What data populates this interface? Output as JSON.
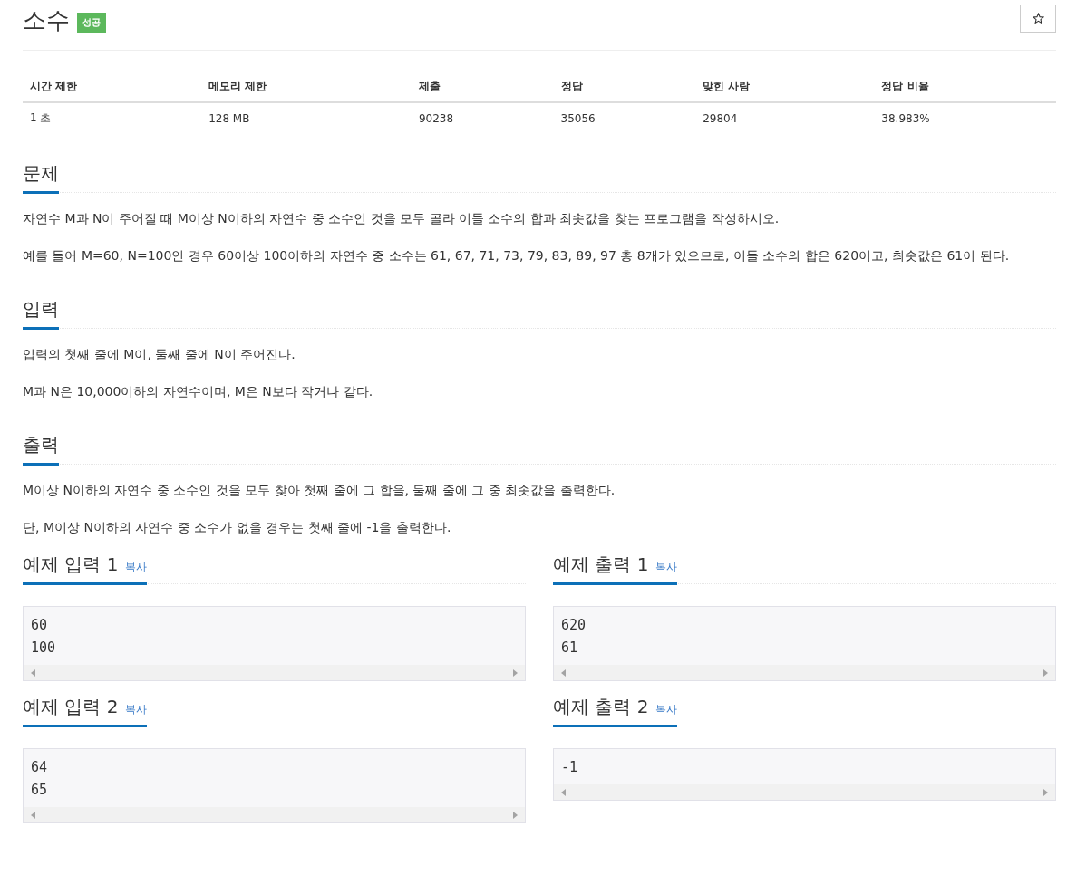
{
  "problem": {
    "title": "소수",
    "badge": "성공"
  },
  "stats": {
    "columns": [
      "시간 제한",
      "메모리 제한",
      "제출",
      "정답",
      "맞힌 사람",
      "정답 비율"
    ],
    "rows": [
      [
        "1 초",
        "128 MB",
        "90238",
        "35056",
        "29804",
        "38.983%"
      ]
    ]
  },
  "sections": [
    {
      "title": "문제",
      "paragraphs": [
        "자연수 M과 N이 주어질 때 M이상 N이하의 자연수 중 소수인 것을 모두 골라 이들 소수의 합과 최솟값을 찾는 프로그램을 작성하시오.",
        "예를 들어 M=60, N=100인 경우 60이상 100이하의 자연수 중 소수는 61, 67, 71, 73, 79, 83, 89, 97 총 8개가 있으므로, 이들 소수의 합은 620이고, 최솟값은 61이 된다."
      ]
    },
    {
      "title": "입력",
      "paragraphs": [
        "입력의 첫째 줄에 M이, 둘째 줄에 N이 주어진다.",
        "M과 N은 10,000이하의 자연수이며, M은 N보다 작거나 같다."
      ]
    },
    {
      "title": "출력",
      "paragraphs": [
        "M이상 N이하의 자연수 중 소수인 것을 모두 찾아 첫째 줄에 그 합을, 둘째 줄에 그 중 최솟값을 출력한다.",
        "단, M이상 N이하의 자연수 중 소수가 없을 경우는 첫째 줄에 -1을 출력한다."
      ]
    }
  ],
  "samples": [
    {
      "input": {
        "title": "예제 입력 1",
        "copy": "복사",
        "lines": [
          "60",
          "100"
        ]
      },
      "output": {
        "title": "예제 출력 1",
        "copy": "복사",
        "lines": [
          "620",
          "61"
        ]
      }
    },
    {
      "input": {
        "title": "예제 입력 2",
        "copy": "복사",
        "lines": [
          "64",
          "65"
        ]
      },
      "output": {
        "title": "예제 출력 2",
        "copy": "복사",
        "lines": [
          "-1"
        ]
      }
    }
  ]
}
